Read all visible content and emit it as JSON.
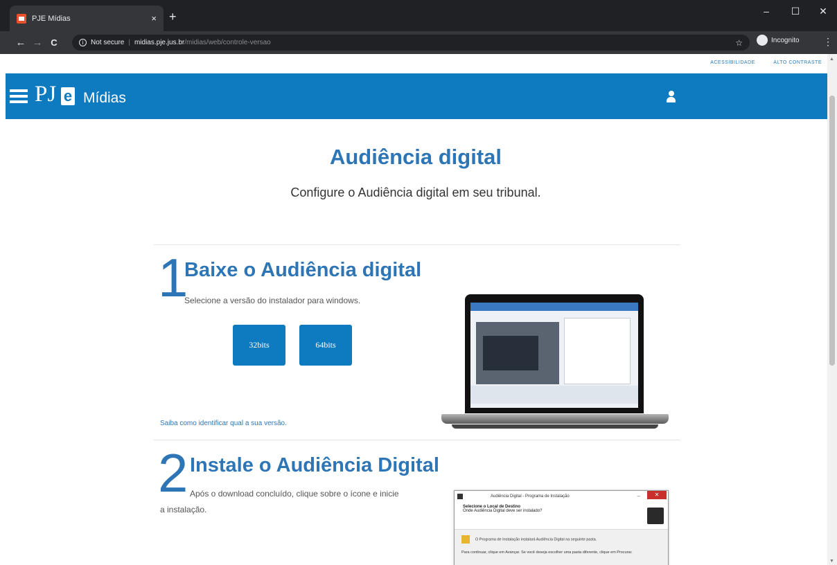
{
  "browser": {
    "tab_title": "PJE Mídias",
    "tab_close": "×",
    "new_tab": "+",
    "minimize": "‒",
    "maximize": "☐",
    "close": "✕",
    "back": "←",
    "forward": "→",
    "reload": "C",
    "security_label": "Not secure",
    "url_host": "midias.pje.jus.br",
    "url_path": "/midias/web/controle-versao",
    "star": "☆",
    "incognito_label": "Incognito",
    "menu": "⋮"
  },
  "page": {
    "top_links": [
      "ACESSIBILIDADE",
      "ALTO CONTRASTE"
    ],
    "header": {
      "logo_p": "PJ",
      "logo_e": "e",
      "brand": "Mídias"
    },
    "title": "Audiência digital",
    "subtitle": "Configure o Audiência digital em seu tribunal.",
    "step1": {
      "number": "1",
      "title": "Baixe o Audiência digital",
      "text": "Selecione a versão do instalador para windows.",
      "buttons": [
        "32bits",
        "64bits"
      ],
      "link": "Saiba como identificar qual a sua versão."
    },
    "step2": {
      "number": "2",
      "title": "Instale o Audiência Digital",
      "text_line1": "Após o download concluído, clique sobre o ícone e inicie",
      "text_line2": "a instalação."
    },
    "installer": {
      "title": "Audiência Digital - Programa de Instalação",
      "close": "✕",
      "minimize": "–",
      "heading": "Selecione o Local de Destino",
      "subheading": "Onde Audiência Digital deve ser instalado?",
      "body_line1": "O Programa de Instalação instalará Audiência Digital na seguinte pasta.",
      "body_line2": "Para continuar, clique em Avançar. Se você deseja escolher uma pasta diferente, clique em Procurar."
    }
  },
  "colors": {
    "header_blue": "#0e7ac0",
    "title_blue": "#2e75b6",
    "browser_dark": "#202124"
  }
}
